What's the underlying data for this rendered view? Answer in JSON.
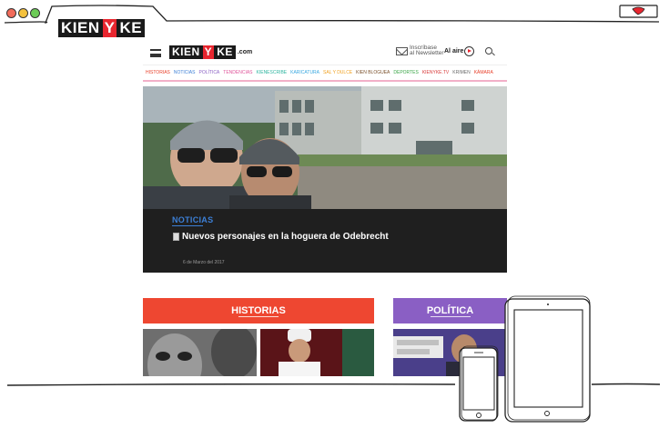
{
  "window": {
    "brand": {
      "part1": "KIEN",
      "part2": "Y",
      "part3": "KE"
    }
  },
  "site": {
    "logo": {
      "part1": "KIEN",
      "part2": "Y",
      "part3": "KE",
      "domain": ".com"
    },
    "newsletter": {
      "line1": "Inscríbase",
      "line2": "al Newsletter"
    },
    "live_label": "Al aire",
    "nav": [
      {
        "label": "HISTORIAS",
        "color": "#e8402a"
      },
      {
        "label": "NOTICIAS",
        "color": "#3c7fd6"
      },
      {
        "label": "POLÍTICA",
        "color": "#8a5fc4"
      },
      {
        "label": "TENDENCIAS",
        "color": "#e0549a"
      },
      {
        "label": "KIENESCRIBE",
        "color": "#2fb5a0"
      },
      {
        "label": "KARICATURA",
        "color": "#38a7e0"
      },
      {
        "label": "SAL Y DULCE",
        "color": "#f0a020"
      },
      {
        "label": "KIEN BLOGUEA",
        "color": "#7a4f2a"
      },
      {
        "label": "DEPORTES",
        "color": "#3aa546"
      },
      {
        "label": "KIENYKE.TV",
        "color": "#d83a3a"
      },
      {
        "label": "KRIMEN",
        "color": "#6b6b6b"
      },
      {
        "label": "KÁMARA",
        "color": "#e8402a"
      }
    ],
    "hero": {
      "category": "NOTICIAS",
      "title": "Nuevos personajes en la hoguera de Odebrecht",
      "date": "6 de Marzo del 2017"
    },
    "sections": [
      {
        "label": "HISTORIAS",
        "color": "#ee4731"
      },
      {
        "label": "POLÍTICA",
        "color": "#8a5fc4"
      }
    ]
  }
}
